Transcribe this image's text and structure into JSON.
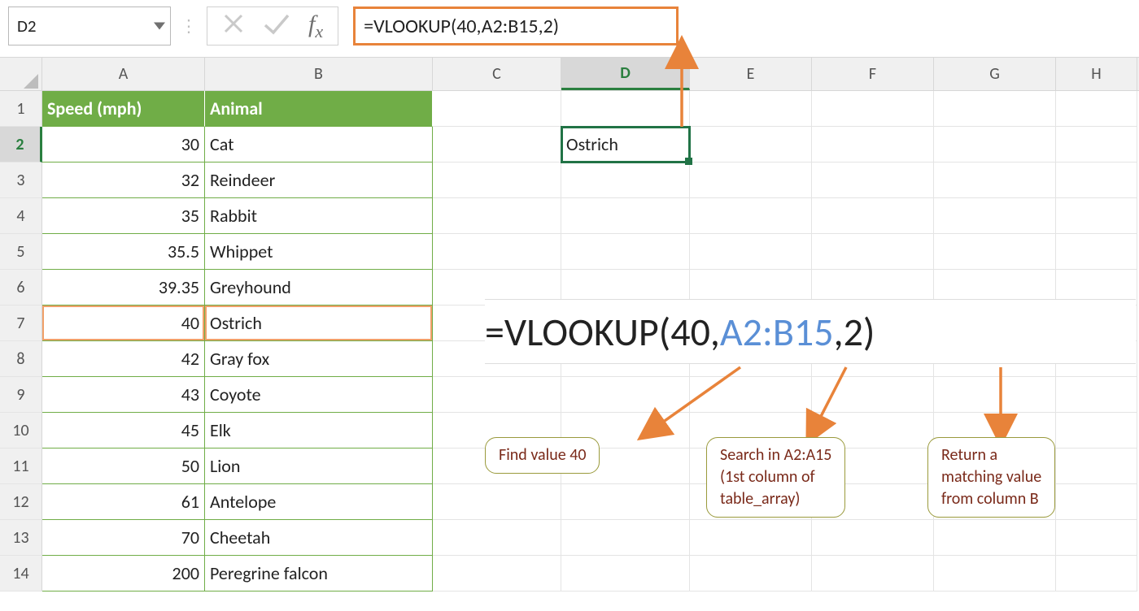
{
  "namebox": {
    "value": "D2"
  },
  "formula_bar": {
    "formula": "=VLOOKUP(40,A2:B15,2)"
  },
  "columns": [
    "A",
    "B",
    "C",
    "D",
    "E",
    "F",
    "G",
    "H"
  ],
  "active_column": "D",
  "active_row": 2,
  "table": {
    "headers": {
      "A": "Speed (mph)",
      "B": "Animal"
    },
    "rows": [
      {
        "speed": "30",
        "animal": "Cat"
      },
      {
        "speed": "32",
        "animal": "Reindeer"
      },
      {
        "speed": "35",
        "animal": "Rabbit"
      },
      {
        "speed": "35.5",
        "animal": "Whippet"
      },
      {
        "speed": "39.35",
        "animal": "Greyhound"
      },
      {
        "speed": "40",
        "animal": "Ostrich"
      },
      {
        "speed": "42",
        "animal": "Gray fox"
      },
      {
        "speed": "43",
        "animal": "Coyote"
      },
      {
        "speed": "45",
        "animal": "Elk"
      },
      {
        "speed": "50",
        "animal": "Lion"
      },
      {
        "speed": "61",
        "animal": "Antelope"
      },
      {
        "speed": "70",
        "animal": "Cheetah"
      },
      {
        "speed": "200",
        "animal": "Peregrine falcon"
      }
    ]
  },
  "highlighted_row_index": 5,
  "result_cell": {
    "ref": "D2",
    "value": "Ostrich"
  },
  "annotation": {
    "formula_parts": {
      "prefix": "=VLOOKUP(",
      "arg1": "40",
      "sep1": ",",
      "arg2": "A2:B15",
      "sep2": ",",
      "arg3": "2",
      "suffix": ")"
    },
    "callouts": {
      "c1": "Find value 40",
      "c2": "Search in A2:A15\n(1st column of\ntable_array)",
      "c3": "Return a\nmatching value\nfrom column B"
    }
  }
}
